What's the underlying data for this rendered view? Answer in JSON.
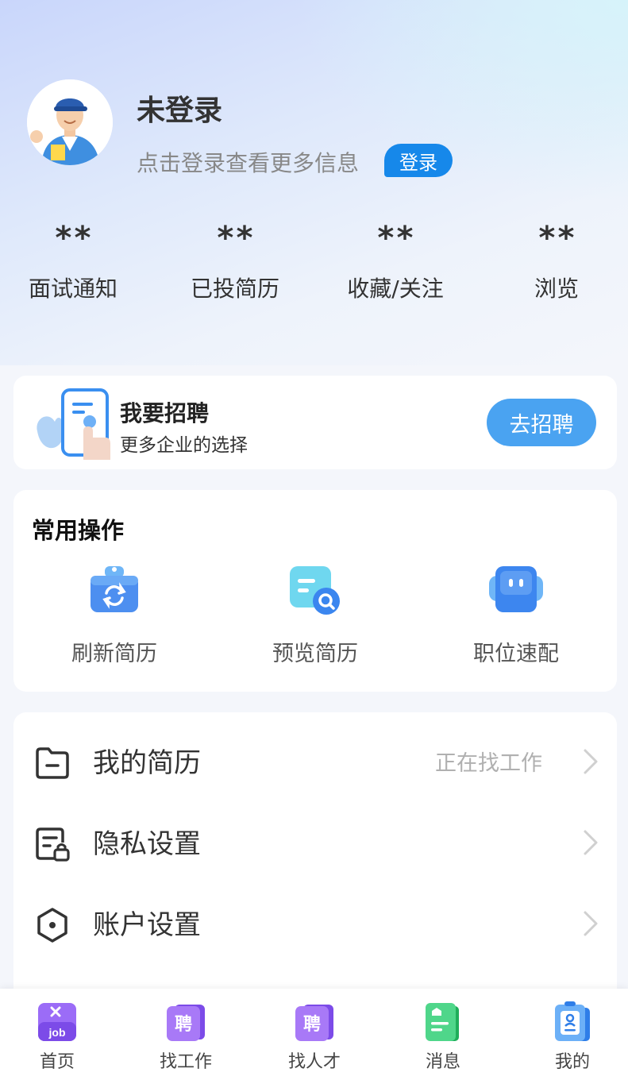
{
  "profile": {
    "name": "未登录",
    "subtitle": "点击登录查看更多信息",
    "login_label": "登录"
  },
  "stats": [
    {
      "value": "**",
      "label": "面试通知"
    },
    {
      "value": "**",
      "label": "已投简历"
    },
    {
      "value": "**",
      "label": "收藏/关注"
    },
    {
      "value": "**",
      "label": "浏览"
    }
  ],
  "recruit": {
    "title": "我要招聘",
    "subtitle": "更多企业的选择",
    "button": "去招聘"
  },
  "common_ops": {
    "title": "常用操作",
    "items": [
      {
        "label": "刷新简历",
        "icon": "refresh-resume-icon"
      },
      {
        "label": "预览简历",
        "icon": "preview-resume-icon"
      },
      {
        "label": "职位速配",
        "icon": "job-match-icon"
      }
    ]
  },
  "menu": [
    {
      "label": "我的简历",
      "value": "正在找工作",
      "icon": "folder-icon"
    },
    {
      "label": "隐私设置",
      "value": "",
      "icon": "privacy-lock-icon"
    },
    {
      "label": "账户设置",
      "value": "",
      "icon": "hexagon-settings-icon"
    }
  ],
  "tabbar": [
    {
      "label": "首页",
      "icon": "home-job-icon",
      "badge_text": "job"
    },
    {
      "label": "找工作",
      "icon": "find-job-icon",
      "badge_text": "聘"
    },
    {
      "label": "找人才",
      "icon": "find-talent-icon",
      "badge_text": "聘"
    },
    {
      "label": "消息",
      "icon": "message-icon"
    },
    {
      "label": "我的",
      "icon": "mine-icon"
    }
  ],
  "colors": {
    "accent": "#1688ea",
    "recruit_button": "#4aa3f1",
    "tab_purple": "#8b5cf6",
    "tab_green": "#2ec36b",
    "tab_blue": "#4a9bf0"
  }
}
